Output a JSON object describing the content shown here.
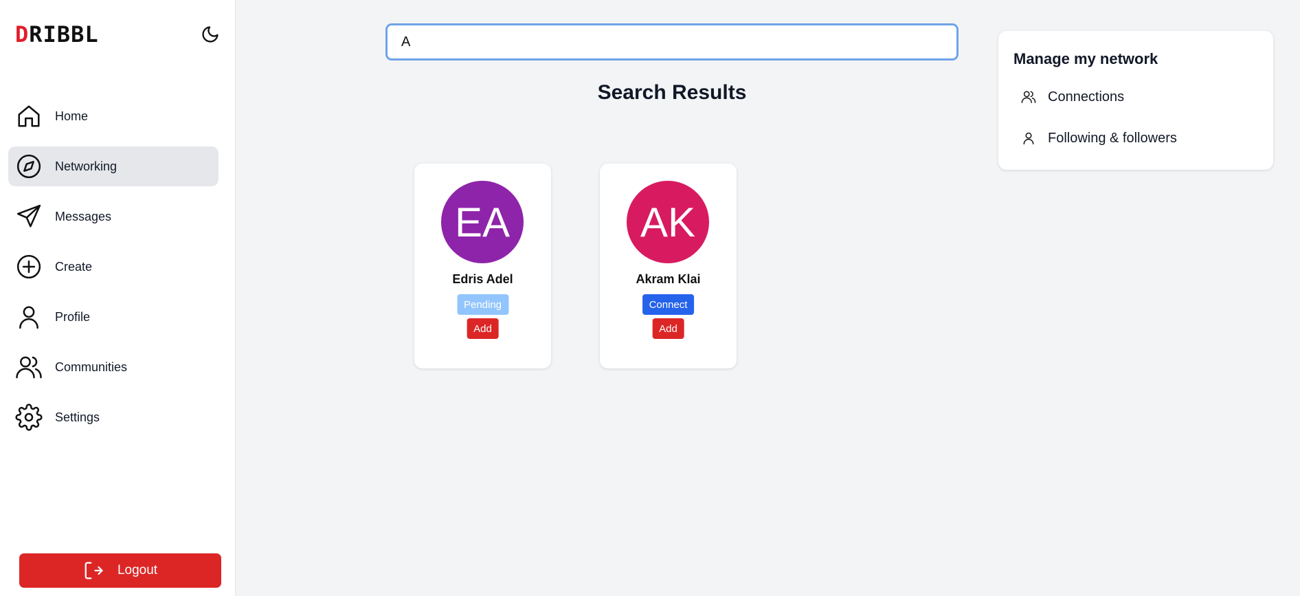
{
  "brand": {
    "logo_first": "D",
    "logo_rest": "RIBBL"
  },
  "sidebar": {
    "items": [
      {
        "label": "Home",
        "icon": "home-icon"
      },
      {
        "label": "Networking",
        "icon": "compass-icon",
        "active": true
      },
      {
        "label": "Messages",
        "icon": "send-icon"
      },
      {
        "label": "Create",
        "icon": "plus-circle-icon"
      },
      {
        "label": "Profile",
        "icon": "user-icon"
      },
      {
        "label": "Communities",
        "icon": "users-icon"
      },
      {
        "label": "Settings",
        "icon": "gear-icon"
      }
    ],
    "logout_label": "Logout"
  },
  "search": {
    "value": "A"
  },
  "results": {
    "title": "Search Results",
    "cards": [
      {
        "initials": "EA",
        "name": "Edris Adel",
        "avatar_color": "#8e24aa",
        "status_label": "Pending",
        "status_color": "#93c5fd",
        "add_label": "Add"
      },
      {
        "initials": "AK",
        "name": "Akram Klai",
        "avatar_color": "#d81b60",
        "status_label": "Connect",
        "status_color": "#2563eb",
        "add_label": "Add"
      }
    ]
  },
  "network_panel": {
    "title": "Manage my network",
    "items": [
      {
        "label": "Connections",
        "icon": "users-icon"
      },
      {
        "label": "Following & followers",
        "icon": "user-icon"
      }
    ]
  },
  "colors": {
    "accent_red": "#dc2626",
    "focus_blue": "#6ea3e8",
    "background": "#f3f4f6"
  }
}
